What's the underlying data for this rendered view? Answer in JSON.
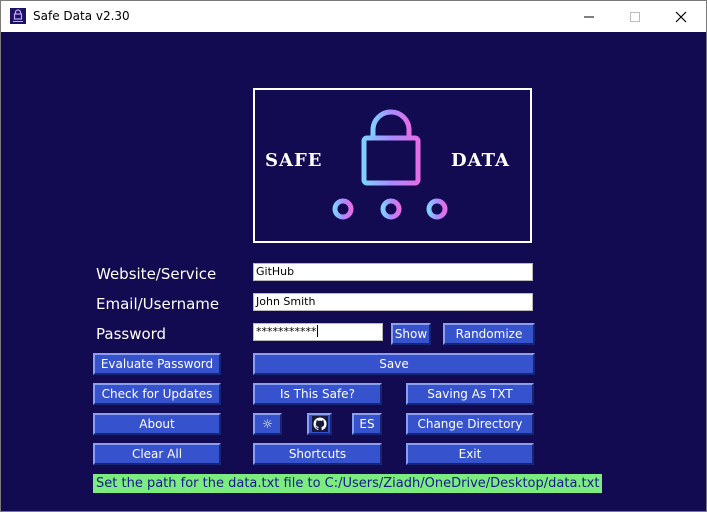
{
  "window": {
    "title": "Safe Data v2.30"
  },
  "logo": {
    "left_word": "SAFE",
    "right_word": "DATA"
  },
  "form": {
    "website_label": "Website/Service",
    "website_value": "GitHub",
    "email_label": "Email/Username",
    "email_value": "John Smith",
    "password_label": "Password",
    "password_value": "***********"
  },
  "buttons": {
    "show": "Show",
    "randomize": "Randomize",
    "evaluate_password": "Evaluate Password",
    "save": "Save",
    "check_updates": "Check for Updates",
    "is_this_safe": "Is This Safe?",
    "saving_as_txt": "Saving As TXT",
    "about": "About",
    "theme": "☼",
    "language": "ES",
    "change_directory": "Change Directory",
    "clear_all": "Clear All",
    "shortcuts": "Shortcuts",
    "exit": "Exit"
  },
  "status": {
    "message": "Set the path for the data.txt file to C:/Users/Ziadh/OneDrive/Desktop/data.txt"
  },
  "colors": {
    "background": "#130b52",
    "button": "#3752cd",
    "status_bg": "#7cec80",
    "status_text": "#151a8a"
  },
  "icons": [
    "app-lock-icon",
    "minimize-icon",
    "maximize-icon",
    "close-icon",
    "github-icon",
    "sun-icon"
  ]
}
